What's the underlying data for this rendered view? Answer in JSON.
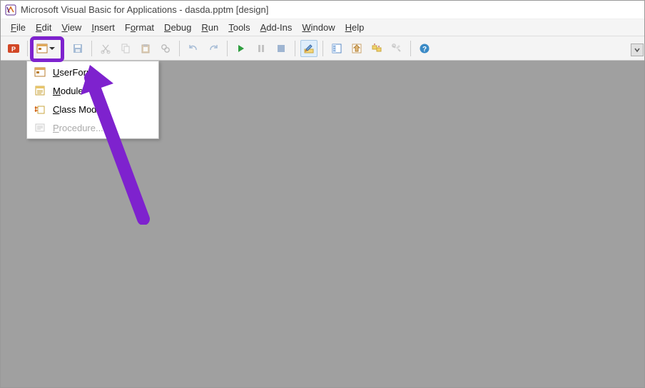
{
  "title": "Microsoft Visual Basic for Applications - dasda.pptm [design]",
  "menu": {
    "file": "File",
    "edit": "Edit",
    "view": "View",
    "insert": "Insert",
    "format": "Format",
    "debug": "Debug",
    "run": "Run",
    "tools": "Tools",
    "addins": "Add-Ins",
    "window": "Window",
    "help": "Help"
  },
  "dropdown": {
    "userform": "UserForm",
    "module": "Module",
    "class_module": "Class Module",
    "procedure": "Procedure..."
  },
  "toolbar": {
    "view_ppt": "view-powerpoint",
    "insert": "insert-object",
    "save": "save",
    "cut": "cut",
    "copy": "copy",
    "paste": "paste",
    "find": "find",
    "undo": "undo",
    "redo": "redo",
    "run": "run",
    "break": "break",
    "reset": "reset",
    "design": "design-mode",
    "explorer": "project-explorer",
    "properties": "properties-window",
    "browser": "object-browser",
    "toolbox": "toolbox",
    "help": "help"
  }
}
